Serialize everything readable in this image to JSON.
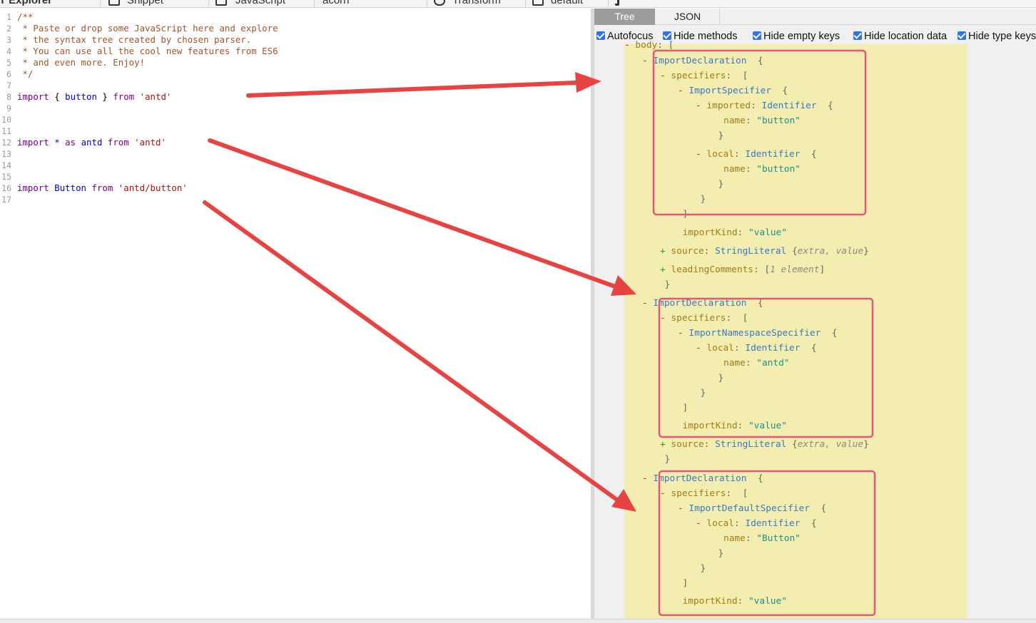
{
  "toolbar": {
    "items": [
      "AST Explorer",
      "Snippet",
      "JavaScript",
      "acorn",
      "Transform",
      "default"
    ]
  },
  "editor": {
    "lines": [
      {
        "num": "1",
        "tokens": [
          {
            "t": "/**",
            "c": "comment"
          }
        ]
      },
      {
        "num": "2",
        "tokens": [
          {
            "t": " * Paste or drop some JavaScript here and explore",
            "c": "comment"
          }
        ]
      },
      {
        "num": "3",
        "tokens": [
          {
            "t": " * the syntax tree created by chosen parser.",
            "c": "comment"
          }
        ]
      },
      {
        "num": "4",
        "tokens": [
          {
            "t": " * You can use all the cool new features from ES6",
            "c": "comment"
          }
        ]
      },
      {
        "num": "5",
        "tokens": [
          {
            "t": " * and even more. Enjoy!",
            "c": "comment"
          }
        ]
      },
      {
        "num": "6",
        "tokens": [
          {
            "t": " */",
            "c": "comment"
          }
        ]
      },
      {
        "num": "7",
        "tokens": []
      },
      {
        "num": "8",
        "tokens": [
          {
            "t": "import",
            "c": "keyword"
          },
          {
            "t": " { ",
            "c": "plain"
          },
          {
            "t": "button",
            "c": "var"
          },
          {
            "t": " } ",
            "c": "plain"
          },
          {
            "t": "from",
            "c": "keyword"
          },
          {
            "t": " ",
            "c": "plain"
          },
          {
            "t": "'antd'",
            "c": "string"
          }
        ]
      },
      {
        "num": "9",
        "tokens": []
      },
      {
        "num": "10",
        "tokens": []
      },
      {
        "num": "11",
        "tokens": []
      },
      {
        "num": "12",
        "tokens": [
          {
            "t": "import",
            "c": "keyword"
          },
          {
            "t": " ",
            "c": "plain"
          },
          {
            "t": "*",
            "c": "op"
          },
          {
            "t": " ",
            "c": "plain"
          },
          {
            "t": "as",
            "c": "keyword"
          },
          {
            "t": " ",
            "c": "plain"
          },
          {
            "t": "antd",
            "c": "var"
          },
          {
            "t": " ",
            "c": "plain"
          },
          {
            "t": "from",
            "c": "keyword"
          },
          {
            "t": " ",
            "c": "plain"
          },
          {
            "t": "'antd'",
            "c": "string"
          }
        ]
      },
      {
        "num": "13",
        "tokens": []
      },
      {
        "num": "14",
        "tokens": []
      },
      {
        "num": "15",
        "tokens": []
      },
      {
        "num": "16",
        "tokens": [
          {
            "t": "import",
            "c": "keyword"
          },
          {
            "t": " ",
            "c": "plain"
          },
          {
            "t": "Button",
            "c": "var"
          },
          {
            "t": " ",
            "c": "plain"
          },
          {
            "t": "from",
            "c": "keyword"
          },
          {
            "t": " ",
            "c": "plain"
          },
          {
            "t": "'antd/button'",
            "c": "string"
          }
        ]
      },
      {
        "num": "17",
        "tokens": []
      }
    ]
  },
  "tabs": {
    "tree": "Tree",
    "json": "JSON"
  },
  "options": [
    {
      "label": "Autofocus",
      "checked": true
    },
    {
      "label": "Hide methods",
      "checked": true
    },
    {
      "label": "Hide empty keys",
      "checked": true
    },
    {
      "label": "Hide location data",
      "checked": true
    },
    {
      "label": "Hide type keys",
      "checked": true
    }
  ],
  "tree": [
    {
      "indent": 0,
      "parts": [
        {
          "t": "- ",
          "c": "minus"
        },
        {
          "t": "body",
          "c": "key"
        },
        {
          "t": ": [",
          "c": "brace"
        }
      ]
    },
    {
      "indent": 1,
      "parts": [
        {
          "t": "- ",
          "c": "minus"
        },
        {
          "t": "ImportDeclaration",
          "c": "type"
        },
        {
          "t": "  {",
          "c": "brace"
        }
      ]
    },
    {
      "indent": 2,
      "parts": [
        {
          "t": "- ",
          "c": "minus"
        },
        {
          "t": "specifiers",
          "c": "key"
        },
        {
          "t": ":  [",
          "c": "brace"
        }
      ]
    },
    {
      "indent": 3,
      "parts": [
        {
          "t": "- ",
          "c": "minus"
        },
        {
          "t": "ImportSpecifier",
          "c": "type"
        },
        {
          "t": "  {",
          "c": "brace"
        }
      ]
    },
    {
      "indent": 4,
      "parts": [
        {
          "t": "- ",
          "c": "minus"
        },
        {
          "t": "imported",
          "c": "key"
        },
        {
          "t": ": ",
          "c": "brace"
        },
        {
          "t": "Identifier",
          "c": "type"
        },
        {
          "t": "  {",
          "c": "brace"
        }
      ]
    },
    {
      "indent": 5,
      "parts": [
        {
          "t": "name",
          "c": "key"
        },
        {
          "t": ": ",
          "c": "brace"
        },
        {
          "t": "\"button\"",
          "c": "str"
        }
      ]
    },
    {
      "indent": 4.7,
      "parts": [
        {
          "t": "}",
          "c": "brace"
        }
      ]
    },
    {
      "indent": 4,
      "parts": [
        {
          "t": "- ",
          "c": "minus"
        },
        {
          "t": "local",
          "c": "key"
        },
        {
          "t": ": ",
          "c": "brace"
        },
        {
          "t": "Identifier",
          "c": "type"
        },
        {
          "t": "  {",
          "c": "brace"
        }
      ]
    },
    {
      "indent": 5,
      "parts": [
        {
          "t": "name",
          "c": "key"
        },
        {
          "t": ": ",
          "c": "brace"
        },
        {
          "t": "\"button\"",
          "c": "str"
        }
      ]
    },
    {
      "indent": 4.7,
      "parts": [
        {
          "t": "}",
          "c": "brace"
        }
      ]
    },
    {
      "indent": 3.7,
      "parts": [
        {
          "t": "}",
          "c": "brace"
        }
      ]
    },
    {
      "indent": 2.7,
      "parts": [
        {
          "t": "]",
          "c": "brace"
        }
      ]
    },
    {
      "indent": 2.7,
      "parts": [
        {
          "t": "importKind",
          "c": "key"
        },
        {
          "t": ": ",
          "c": "brace"
        },
        {
          "t": "\"value\"",
          "c": "str"
        }
      ]
    },
    {
      "indent": 2,
      "parts": [
        {
          "t": "+ ",
          "c": "plus"
        },
        {
          "t": "source",
          "c": "key"
        },
        {
          "t": ": ",
          "c": "brace"
        },
        {
          "t": "StringLiteral",
          "c": "type"
        },
        {
          "t": " {",
          "c": "brace"
        },
        {
          "t": "extra, value",
          "c": "meta"
        },
        {
          "t": "}",
          "c": "brace"
        }
      ]
    },
    {
      "indent": 2,
      "parts": [
        {
          "t": "+ ",
          "c": "plus"
        },
        {
          "t": "leadingComments",
          "c": "key"
        },
        {
          "t": ": [",
          "c": "brace"
        },
        {
          "t": "1 element",
          "c": "meta"
        },
        {
          "t": "]",
          "c": "brace"
        }
      ]
    },
    {
      "indent": 1.7,
      "parts": [
        {
          "t": "}",
          "c": "brace"
        }
      ]
    },
    {
      "indent": 1,
      "parts": [
        {
          "t": "- ",
          "c": "minus"
        },
        {
          "t": "ImportDeclaration",
          "c": "type"
        },
        {
          "t": "  {",
          "c": "brace"
        }
      ]
    },
    {
      "indent": 2,
      "parts": [
        {
          "t": "- ",
          "c": "minus"
        },
        {
          "t": "specifiers",
          "c": "key"
        },
        {
          "t": ":  [",
          "c": "brace"
        }
      ]
    },
    {
      "indent": 3,
      "parts": [
        {
          "t": "- ",
          "c": "minus"
        },
        {
          "t": "ImportNamespaceSpecifier",
          "c": "type"
        },
        {
          "t": "  {",
          "c": "brace"
        }
      ]
    },
    {
      "indent": 4,
      "parts": [
        {
          "t": "- ",
          "c": "minus"
        },
        {
          "t": "local",
          "c": "key"
        },
        {
          "t": ": ",
          "c": "brace"
        },
        {
          "t": "Identifier",
          "c": "type"
        },
        {
          "t": "  {",
          "c": "brace"
        }
      ]
    },
    {
      "indent": 5,
      "parts": [
        {
          "t": "name",
          "c": "key"
        },
        {
          "t": ": ",
          "c": "brace"
        },
        {
          "t": "\"antd\"",
          "c": "str"
        }
      ]
    },
    {
      "indent": 4.7,
      "parts": [
        {
          "t": "}",
          "c": "brace"
        }
      ]
    },
    {
      "indent": 3.7,
      "parts": [
        {
          "t": "}",
          "c": "brace"
        }
      ]
    },
    {
      "indent": 2.7,
      "parts": [
        {
          "t": "]",
          "c": "brace"
        }
      ]
    },
    {
      "indent": 2.7,
      "parts": [
        {
          "t": "importKind",
          "c": "key"
        },
        {
          "t": ": ",
          "c": "brace"
        },
        {
          "t": "\"value\"",
          "c": "str"
        }
      ]
    },
    {
      "indent": 2,
      "parts": [
        {
          "t": "+ ",
          "c": "plus"
        },
        {
          "t": "source",
          "c": "key"
        },
        {
          "t": ": ",
          "c": "brace"
        },
        {
          "t": "StringLiteral",
          "c": "type"
        },
        {
          "t": " {",
          "c": "brace"
        },
        {
          "t": "extra, value",
          "c": "meta"
        },
        {
          "t": "}",
          "c": "brace"
        }
      ]
    },
    {
      "indent": 1.7,
      "parts": [
        {
          "t": "}",
          "c": "brace"
        }
      ]
    },
    {
      "indent": 1,
      "parts": [
        {
          "t": "- ",
          "c": "minus"
        },
        {
          "t": "ImportDeclaration",
          "c": "type"
        },
        {
          "t": "  {",
          "c": "brace"
        }
      ]
    },
    {
      "indent": 2,
      "parts": [
        {
          "t": "- ",
          "c": "minus"
        },
        {
          "t": "specifiers",
          "c": "key"
        },
        {
          "t": ":  [",
          "c": "brace"
        }
      ]
    },
    {
      "indent": 3,
      "parts": [
        {
          "t": "- ",
          "c": "minus"
        },
        {
          "t": "ImportDefaultSpecifier",
          "c": "type"
        },
        {
          "t": "  {",
          "c": "brace"
        }
      ]
    },
    {
      "indent": 4,
      "parts": [
        {
          "t": "- ",
          "c": "minus"
        },
        {
          "t": "local",
          "c": "key"
        },
        {
          "t": ": ",
          "c": "brace"
        },
        {
          "t": "Identifier",
          "c": "type"
        },
        {
          "t": "  {",
          "c": "brace"
        }
      ]
    },
    {
      "indent": 5,
      "parts": [
        {
          "t": "name",
          "c": "key"
        },
        {
          "t": ": ",
          "c": "brace"
        },
        {
          "t": "\"Button\"",
          "c": "str"
        }
      ]
    },
    {
      "indent": 4.7,
      "parts": [
        {
          "t": "}",
          "c": "brace"
        }
      ]
    },
    {
      "indent": 3.7,
      "parts": [
        {
          "t": "}",
          "c": "brace"
        }
      ]
    },
    {
      "indent": 2.7,
      "parts": [
        {
          "t": "]",
          "c": "brace"
        }
      ]
    },
    {
      "indent": 2.7,
      "parts": [
        {
          "t": "importKind",
          "c": "key"
        },
        {
          "t": ": ",
          "c": "brace"
        },
        {
          "t": "\"value\"",
          "c": "str"
        }
      ]
    }
  ],
  "colors": {
    "annotation_arrow": "#e84343",
    "highlight_box": "#e2587a",
    "tree_background": "#f3eeaf",
    "checkbox": "#2f73e8"
  }
}
